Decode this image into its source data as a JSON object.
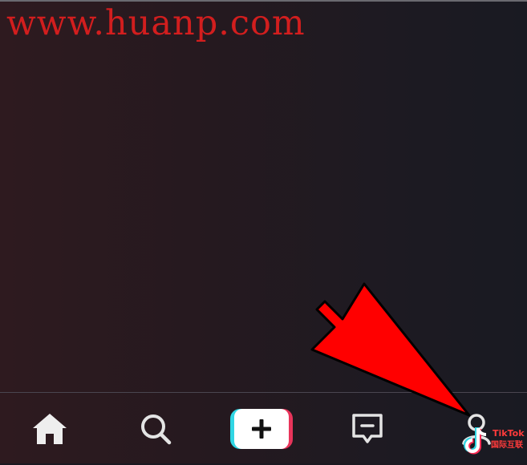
{
  "watermark": {
    "text": "www.huanp.com",
    "color": "#d21e1e"
  },
  "nav": {
    "items": [
      {
        "id": "home",
        "icon": "home-icon"
      },
      {
        "id": "discover",
        "icon": "search-icon"
      },
      {
        "id": "create",
        "icon": "plus-icon"
      },
      {
        "id": "inbox",
        "icon": "message-icon"
      },
      {
        "id": "profile",
        "icon": "person-icon"
      }
    ]
  },
  "overlay": {
    "arrow_color": "#ff0000",
    "logo": {
      "name": "TikTok",
      "subtitle": "国际互联"
    }
  },
  "colors": {
    "accent_cyan": "#30d6e4",
    "accent_red": "#e8345a",
    "icon": "#e8e8e8"
  }
}
